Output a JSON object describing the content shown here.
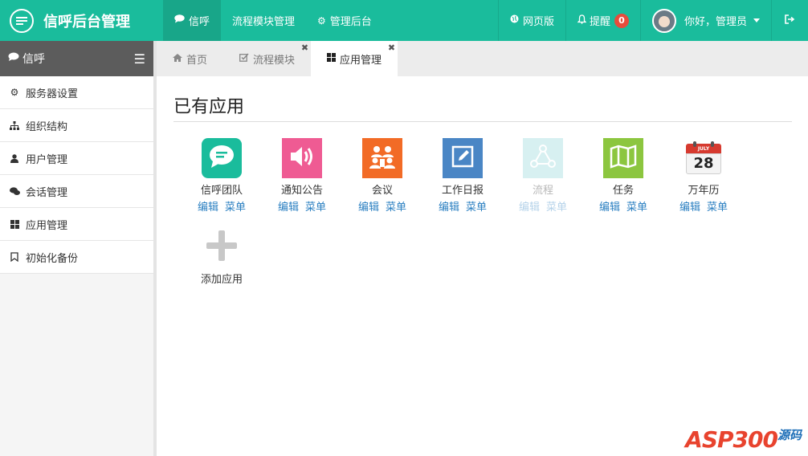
{
  "brand": {
    "title": "信呼后台管理"
  },
  "topnav": [
    {
      "label": "信呼",
      "icon": "chat-icon"
    },
    {
      "label": "流程模块管理"
    },
    {
      "label": "管理后台",
      "icon": "gear-icon"
    }
  ],
  "topright": {
    "web_label": "网页版",
    "remind_label": "提醒",
    "remind_count": "0",
    "user_label": "你好，管理员"
  },
  "sidebar": {
    "title": "信呼",
    "items": [
      {
        "label": "服务器设置",
        "icon": "gear-icon"
      },
      {
        "label": "组织结构",
        "icon": "sitemap-icon"
      },
      {
        "label": "用户管理",
        "icon": "user-icon"
      },
      {
        "label": "会话管理",
        "icon": "comments-icon"
      },
      {
        "label": "应用管理",
        "icon": "grid-icon"
      },
      {
        "label": "初始化备份",
        "icon": "bookmark-icon"
      }
    ]
  },
  "tabs": [
    {
      "label": "首页",
      "icon": "home-icon"
    },
    {
      "label": "流程模块",
      "icon": "checkbox-icon"
    },
    {
      "label": "应用管理",
      "icon": "grid-icon"
    }
  ],
  "main": {
    "title": "已有应用",
    "apps": [
      {
        "name": "信呼团队",
        "edit": "编辑",
        "menu": "菜单",
        "color": "#1abc9c"
      },
      {
        "name": "通知公告",
        "edit": "编辑",
        "menu": "菜单",
        "color": "#ef5b93"
      },
      {
        "name": "会议",
        "edit": "编辑",
        "menu": "菜单",
        "color": "#f26b26"
      },
      {
        "name": "工作日报",
        "edit": "编辑",
        "menu": "菜单",
        "color": "#4a86c5"
      },
      {
        "name": "流程",
        "edit": "编辑",
        "menu": "菜单",
        "color": "#8fd6d8"
      },
      {
        "name": "任务",
        "edit": "编辑",
        "menu": "菜单",
        "color": "#8cc63f"
      },
      {
        "name": "万年历",
        "edit": "编辑",
        "menu": "菜单",
        "calendar_month": "JULY",
        "calendar_day": "28"
      }
    ],
    "add_label": "添加应用"
  },
  "watermark": {
    "text": "ASP300",
    "suffix": "源码"
  }
}
